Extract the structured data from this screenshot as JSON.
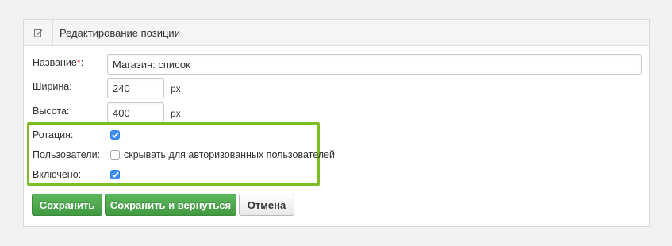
{
  "panel": {
    "title": "Редактирование позиции",
    "title_icon": "edit-icon"
  },
  "fields": {
    "name": {
      "label": "Название",
      "required_mark": "*",
      "colon": ":",
      "value": "Магазин: список"
    },
    "width": {
      "label": "Ширина:",
      "value": "240",
      "unit": "px"
    },
    "height": {
      "label": "Высота:",
      "value": "400",
      "unit": "px"
    },
    "rotation": {
      "label": "Ротация:",
      "checked": true
    },
    "users": {
      "label": "Пользователи:",
      "checkbox_text": "скрывать для авторизованных пользователей",
      "checked": false
    },
    "enabled": {
      "label": "Включено:",
      "checked": true
    }
  },
  "buttons": {
    "save": "Сохранить",
    "save_return": "Сохранить и вернуться",
    "cancel": "Отмена"
  },
  "colors": {
    "highlight": "#7cbd24",
    "checkbox_checked": "#3e90f5",
    "button_green": "#5cb85c",
    "required": "#e0443a"
  }
}
